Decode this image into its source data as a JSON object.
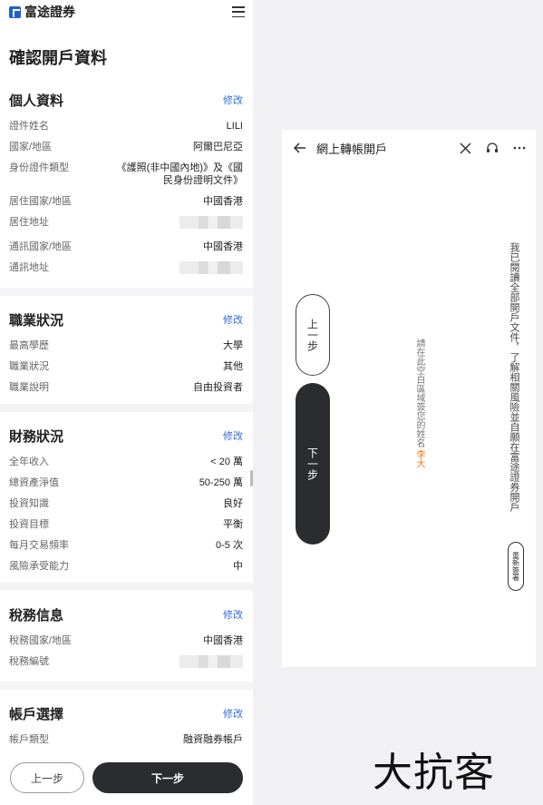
{
  "app": {
    "logo_text": "富途證券"
  },
  "page": {
    "title": "確認開戶資料"
  },
  "sections": [
    {
      "title": "個人資料",
      "edit": "修改",
      "rows": [
        {
          "label": "證件姓名",
          "value": "LILI"
        },
        {
          "label": "國家/地區",
          "value": "阿爾巴尼亞"
        },
        {
          "label": "身份證件類型",
          "value": "《護照(非中國內地)》及《國民身份證明文件》"
        },
        {
          "label": "居住國家/地區",
          "value": "中國香港"
        },
        {
          "label": "居住地址",
          "value": "",
          "blurred": true
        },
        {
          "label": "通訊國家/地區",
          "value": "中國香港"
        },
        {
          "label": "通訊地址",
          "value": "",
          "blurred": true
        }
      ]
    },
    {
      "title": "職業狀況",
      "edit": "修改",
      "rows": [
        {
          "label": "最高學歷",
          "value": "大學"
        },
        {
          "label": "職業狀況",
          "value": "其他"
        },
        {
          "label": "職業說明",
          "value": "自由投資者"
        }
      ]
    },
    {
      "title": "財務狀況",
      "edit": "修改",
      "rows": [
        {
          "label": "全年收入",
          "value": "< 20 萬"
        },
        {
          "label": "總資產淨值",
          "value": "50-250 萬"
        },
        {
          "label": "投資知識",
          "value": "良好"
        },
        {
          "label": "投資目標",
          "value": "平衡"
        },
        {
          "label": "每月交易頻率",
          "value": "0-5 次"
        },
        {
          "label": "風險承受能力",
          "value": "中"
        }
      ]
    },
    {
      "title": "稅務信息",
      "edit": "修改",
      "rows": [
        {
          "label": "稅務國家/地區",
          "value": "中國香港"
        },
        {
          "label": "稅務編號",
          "value": "",
          "blurred": true
        }
      ]
    },
    {
      "title": "帳戶選擇",
      "edit": "修改",
      "rows": [
        {
          "label": "帳戶類型",
          "value": "融資融券帳戶"
        }
      ]
    }
  ],
  "footer": {
    "prev": "上一步",
    "next": "下一步"
  },
  "phone": {
    "title": "網上轉帳開戶",
    "statement": "我已閱讀全部開戶文件，了解相關風險並自願在富途證券開戶",
    "resign": "重新簽署",
    "sign_hint": "請在此空白區域簽您的姓名",
    "sign_name": "李大",
    "prev": "上一步",
    "next": "下一步"
  },
  "watermark": "大抗客",
  "colors": {
    "accent": "#2f6bdc",
    "dark_button": "#2a2c30",
    "signature": "#f07a1a"
  },
  "icons": [
    "menu-icon",
    "back-arrow-icon",
    "close-icon",
    "headset-icon",
    "more-icon"
  ]
}
